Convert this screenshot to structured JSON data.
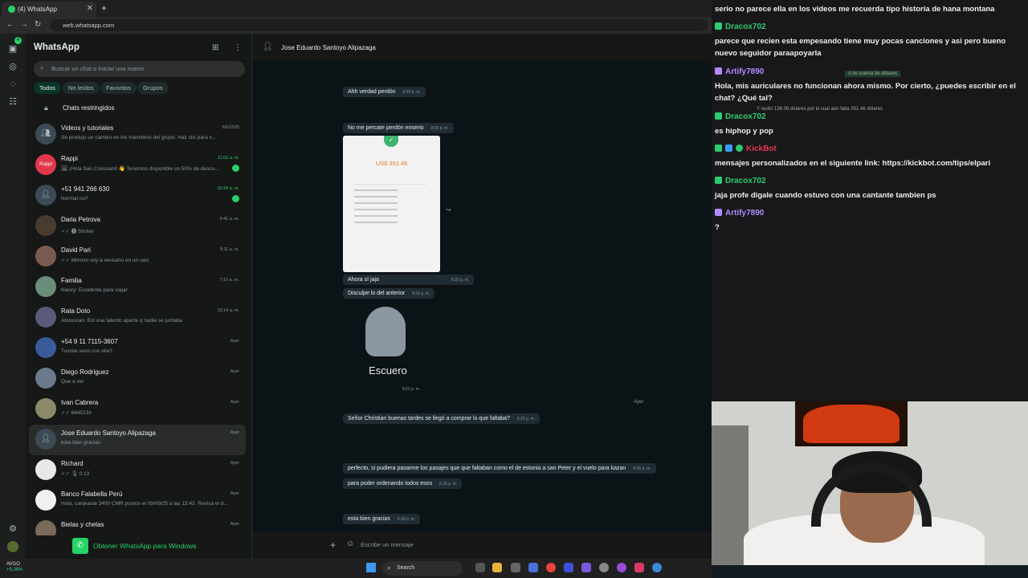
{
  "browser": {
    "tab_title": "(4) WhatsApp",
    "new_tab": "+",
    "url": "web.whatsapp.com"
  },
  "rail": {
    "badge": "4"
  },
  "sidebar": {
    "title": "WhatsApp",
    "search_placeholder": "Buscar un chat o iniciar uno nuevo",
    "filters": [
      "Todos",
      "No leídos",
      "Favoritos",
      "Grupos"
    ],
    "restricted": "Chats restringidos",
    "chats": [
      {
        "name": "Videos y tutoriales",
        "preview": "Se produjo un cambio en los miembros del grupo. Haz clic para v...",
        "time": "6/5/2025"
      },
      {
        "name": "Rappi",
        "preview": "🖼 ¡Hola San Croissant! 👋 Tenemos disponible un 50% de descu...",
        "time": "11:02 a. m."
      },
      {
        "name": "+51 941 266 630",
        "preview": "Normal no?",
        "time": "10:24 a. m."
      },
      {
        "name": "Daria Petrova",
        "preview": "✓✓ 🅢 Sticker",
        "time": "9:41 a. m."
      },
      {
        "name": "David Pari",
        "preview": "✓✓ Mmmm voy a revisarlo en un rato",
        "time": "9:11 a. m."
      },
      {
        "name": "Familia",
        "preview": "Nancy: Excelente para viajar",
        "time": "7:10 a. m."
      },
      {
        "name": "Rata Doto",
        "preview": "Abduscan: Em ese talento aparte q nadie se juntaba",
        "time": "12:14 a. m."
      },
      {
        "name": "+54 9 11 7115-3607",
        "preview": "Tuviste sexo con ella?",
        "time": "Ayer"
      },
      {
        "name": "Diego Rodriguez",
        "preview": "Que a ver",
        "time": "Ayer"
      },
      {
        "name": "Ivan Cabrera",
        "preview": "✓✓ 664513#",
        "time": "Ayer"
      },
      {
        "name": "Jose Eduardo Santoyo Alipazaga",
        "preview": "esta bien gracias",
        "time": "Ayer"
      },
      {
        "name": "Richard",
        "preview": "✓✓ 🎙 0:13",
        "time": "Ayer"
      },
      {
        "name": "Banco Falabella Perú",
        "preview": "Hola, canjeaste 3400 CMR puntos el 09/09/25 a las 13:43. Revisa el d...",
        "time": "Ayer"
      },
      {
        "name": "Bielas y chelas",
        "preview": "",
        "time": "Ayer"
      }
    ],
    "get_windows": "Obtener WhatsApp para Windows"
  },
  "conversation": {
    "contact": "Jose Eduardo Santoyo Alipazaga",
    "messages": [
      {
        "text": "Ahh verdad perdón",
        "time": "8:20 p. m."
      },
      {
        "text": "No me percate perdón enserio",
        "time": "8:20 p. m."
      },
      {
        "text": "Ahora sí jaja",
        "time": "8:22 p. m."
      },
      {
        "text": "Disculpe lo del anterior",
        "time": "8:22 p. m."
      },
      {
        "text": "Señor Christian buenas tardes se llegó a comprar lo que faltaba?",
        "time": "6:22 p. m."
      },
      {
        "text": "perfecto, si pudiera pasarme los pasajes que que faltaban como el de estonia a san Peter y el vuelo para kazan",
        "time": "6:26 p. m."
      },
      {
        "text": "para poder ordenando todos esos",
        "time": "6:25 p. m."
      },
      {
        "text": "esta bien gracias",
        "time": "6:30 p. m."
      }
    ],
    "receipt_amount": "US$ 351.46",
    "sticker_caption": "Escuero",
    "sticker_time": "8:22 p. m.",
    "day_label": "Ayer",
    "compose_placeholder": "Escribe un mensaje"
  },
  "stream_chat": {
    "lines": [
      {
        "kind": "text",
        "text": "serio no parece ella en los videos me recuerda tipo historia de hana montana"
      },
      {
        "kind": "user",
        "user": "Dracox702",
        "color": "green"
      },
      {
        "kind": "text",
        "text": "parece que recien esta empesando tiene muy pocas canciones y asi pero bueno nuevo seguidor paraapoyarla"
      },
      {
        "kind": "user",
        "user": "Artify7890",
        "color": "purple"
      },
      {
        "kind": "text",
        "text": "Hola, mis auriculares no funcionan ahora mismo. Por cierto, ¿puedes escribir en el chat? ¿Qué tal?"
      },
      {
        "kind": "user",
        "user": "Dracox702",
        "color": "green"
      },
      {
        "kind": "text",
        "text": "es hiphop y pop"
      },
      {
        "kind": "user",
        "user": "KickBot",
        "color": "red"
      },
      {
        "kind": "text",
        "text": "mensajes personalizados en el siguiente link: https://kickbot.com/tips/elpari"
      },
      {
        "kind": "user",
        "user": "Dracox702",
        "color": "green"
      },
      {
        "kind": "text",
        "text": "jaja profe digale cuando estuvo con una cantante tambien ps"
      },
      {
        "kind": "user",
        "user": "Artify7890",
        "color": "purple"
      },
      {
        "kind": "text",
        "text": "?"
      }
    ],
    "faded_snippets": [
      "A mi cuenta de dólares",
      "Y recibí 136.06 dólares por lo cual aún falta 351.46 dólares"
    ]
  },
  "taskbar": {
    "stock_name": "AVGO",
    "stock_change": "+9.36%",
    "search_label": "Search"
  }
}
